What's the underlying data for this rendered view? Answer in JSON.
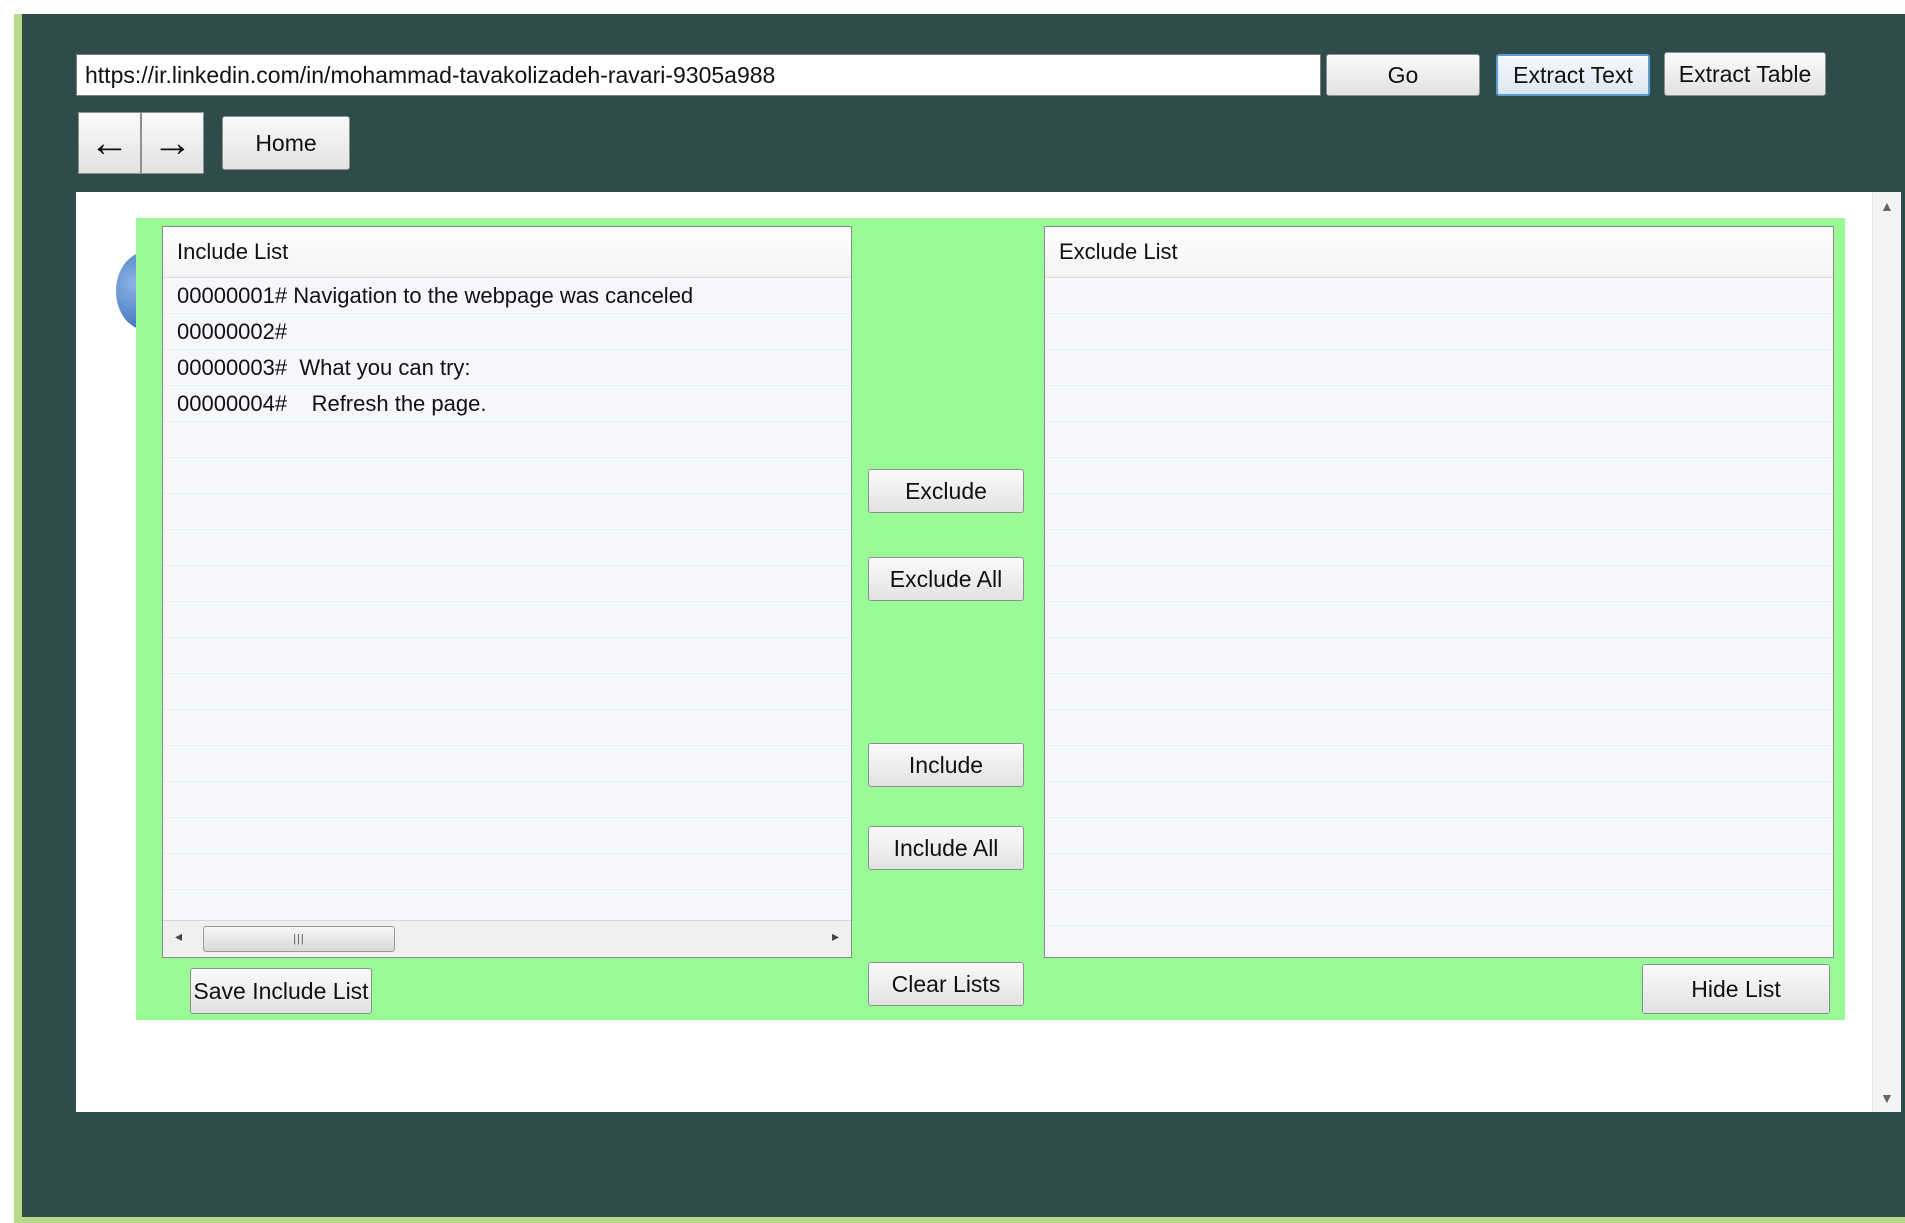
{
  "toolbar": {
    "url_value": "https://ir.linkedin.com/in/mohammad-tavakolizadeh-ravari-9305a988",
    "go_label": "Go",
    "extract_text_label": "Extract Text",
    "extract_table_label": "Extract Table",
    "home_label": "Home",
    "back_icon": "←",
    "forward_icon": "→"
  },
  "include_list": {
    "header": "Include List",
    "rows": [
      "00000001# Navigation to the webpage was canceled",
      "00000002#",
      "00000003#  What you can try:",
      "00000004#    Refresh the page."
    ],
    "scroll_thumb_grip": "|||"
  },
  "exclude_list": {
    "header": "Exclude List"
  },
  "actions": {
    "exclude_label": "Exclude",
    "exclude_all_label": "Exclude All",
    "include_label": "Include",
    "include_all_label": "Include All",
    "clear_lists_label": "Clear Lists",
    "save_include_list_label": "Save Include List",
    "hide_list_label": "Hide List"
  },
  "colors": {
    "frame_background": "#2d4c4a",
    "panel_background": "#98fb98",
    "focused_border": "#5b9ed6"
  }
}
